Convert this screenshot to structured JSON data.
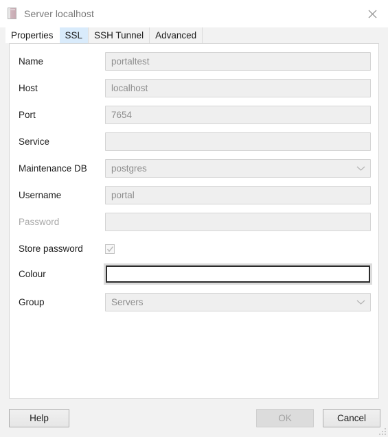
{
  "window": {
    "title": "Server localhost",
    "icon": "server-icon",
    "close_icon": "close-icon"
  },
  "tabs": [
    {
      "label": "Properties",
      "state": "selected"
    },
    {
      "label": "SSL",
      "state": "hover"
    },
    {
      "label": "SSH Tunnel",
      "state": "normal"
    },
    {
      "label": "Advanced",
      "state": "normal"
    }
  ],
  "form": {
    "name": {
      "label": "Name",
      "value": "portaltest"
    },
    "host": {
      "label": "Host",
      "value": "localhost"
    },
    "port": {
      "label": "Port",
      "value": "7654"
    },
    "service": {
      "label": "Service",
      "value": ""
    },
    "maintenance_db": {
      "label": "Maintenance DB",
      "value": "postgres"
    },
    "username": {
      "label": "Username",
      "value": "portal"
    },
    "password": {
      "label": "Password",
      "value": ""
    },
    "store_password": {
      "label": "Store password",
      "checked": true
    },
    "colour": {
      "label": "Colour",
      "value": ""
    },
    "group": {
      "label": "Group",
      "value": "Servers"
    }
  },
  "footer": {
    "help_label": "Help",
    "ok_label": "OK",
    "cancel_label": "Cancel"
  },
  "colors": {
    "tab_hover": "#d9ebfb",
    "field_bg": "#efefef",
    "focus_border": "#2b2b2b",
    "disabled_text": "#a8a8a8"
  }
}
